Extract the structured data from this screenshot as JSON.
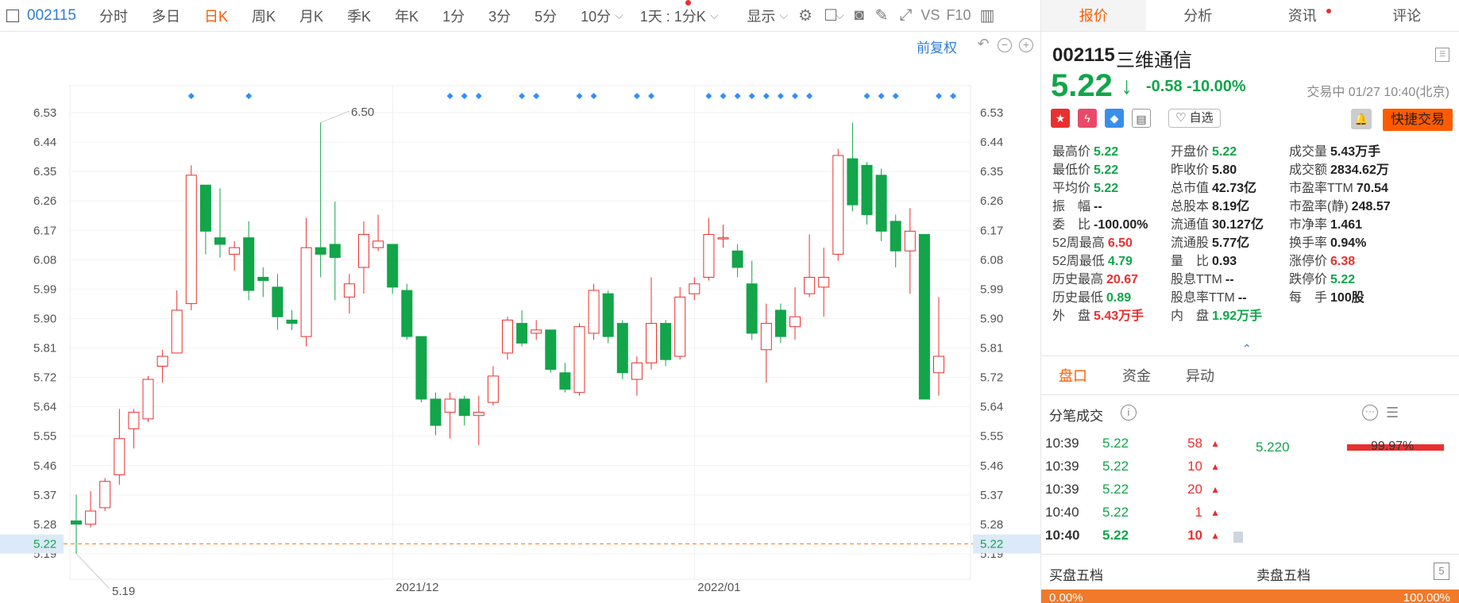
{
  "toolbar": {
    "code": "002115",
    "items": [
      "分时",
      "多日",
      "日K",
      "周K",
      "月K",
      "季K",
      "年K",
      "1分",
      "3分",
      "5分",
      "10分"
    ],
    "active_index": 2,
    "period_select": "1天 : 1分K",
    "display_label": "显示",
    "vs_label": "VS",
    "f10_label": "F10"
  },
  "chart": {
    "fuquan_label": "前复权",
    "max_label": "6.50",
    "min_label": "5.19",
    "current_price_label": "5.22"
  },
  "chart_data": {
    "type": "candlestick",
    "y_ticks": [
      "6.53",
      "6.44",
      "6.35",
      "6.26",
      "6.17",
      "6.08",
      "5.99",
      "5.90",
      "5.81",
      "5.72",
      "5.64",
      "5.55",
      "5.46",
      "5.37",
      "5.28",
      "5.19"
    ],
    "ylim": [
      5.19,
      6.53
    ],
    "x_labels": [
      "2021/12",
      "2022/01"
    ],
    "x_label_positions": [
      22,
      43
    ],
    "candles": [
      {
        "o": 5.29,
        "c": 5.28,
        "h": 5.37,
        "l": 5.19
      },
      {
        "o": 5.28,
        "c": 5.32,
        "h": 5.38,
        "l": 5.27
      },
      {
        "o": 5.33,
        "c": 5.41,
        "h": 5.42,
        "l": 5.32
      },
      {
        "o": 5.43,
        "c": 5.54,
        "h": 5.63,
        "l": 5.4
      },
      {
        "o": 5.57,
        "c": 5.62,
        "h": 5.63,
        "l": 5.51
      },
      {
        "o": 5.6,
        "c": 5.72,
        "h": 5.73,
        "l": 5.59
      },
      {
        "o": 5.76,
        "c": 5.79,
        "h": 5.81,
        "l": 5.71
      },
      {
        "o": 5.8,
        "c": 5.93,
        "h": 5.99,
        "l": 5.8
      },
      {
        "o": 5.95,
        "c": 6.34,
        "h": 6.37,
        "l": 5.93
      },
      {
        "o": 6.31,
        "c": 6.17,
        "h": 6.31,
        "l": 6.1
      },
      {
        "o": 6.15,
        "c": 6.13,
        "h": 6.3,
        "l": 6.09
      },
      {
        "o": 6.1,
        "c": 6.12,
        "h": 6.14,
        "l": 6.05
      },
      {
        "o": 6.15,
        "c": 5.99,
        "h": 6.2,
        "l": 5.96
      },
      {
        "o": 6.03,
        "c": 6.02,
        "h": 6.06,
        "l": 5.97
      },
      {
        "o": 6.0,
        "c": 5.91,
        "h": 6.04,
        "l": 5.87
      },
      {
        "o": 5.9,
        "c": 5.89,
        "h": 5.93,
        "l": 5.87
      },
      {
        "o": 5.85,
        "c": 6.12,
        "h": 6.21,
        "l": 5.82
      },
      {
        "o": 6.12,
        "c": 6.1,
        "h": 6.5,
        "l": 6.03
      },
      {
        "o": 6.13,
        "c": 6.09,
        "h": 6.26,
        "l": 5.96
      },
      {
        "o": 5.97,
        "c": 6.01,
        "h": 6.04,
        "l": 5.92
      },
      {
        "o": 6.06,
        "c": 6.16,
        "h": 6.2,
        "l": 5.98
      },
      {
        "o": 6.12,
        "c": 6.14,
        "h": 6.22,
        "l": 6.11
      },
      {
        "o": 6.13,
        "c": 6.0,
        "h": 6.13,
        "l": 5.98
      },
      {
        "o": 5.99,
        "c": 5.85,
        "h": 6.01,
        "l": 5.84
      },
      {
        "o": 5.85,
        "c": 5.66,
        "h": 5.85,
        "l": 5.65
      },
      {
        "o": 5.66,
        "c": 5.58,
        "h": 5.68,
        "l": 5.55
      },
      {
        "o": 5.62,
        "c": 5.66,
        "h": 5.68,
        "l": 5.54
      },
      {
        "o": 5.66,
        "c": 5.61,
        "h": 5.67,
        "l": 5.58
      },
      {
        "o": 5.61,
        "c": 5.62,
        "h": 5.67,
        "l": 5.52
      },
      {
        "o": 5.65,
        "c": 5.73,
        "h": 5.76,
        "l": 5.64
      },
      {
        "o": 5.8,
        "c": 5.9,
        "h": 5.91,
        "l": 5.78
      },
      {
        "o": 5.89,
        "c": 5.83,
        "h": 5.93,
        "l": 5.82
      },
      {
        "o": 5.86,
        "c": 5.87,
        "h": 5.9,
        "l": 5.84
      },
      {
        "o": 5.87,
        "c": 5.75,
        "h": 5.87,
        "l": 5.74
      },
      {
        "o": 5.74,
        "c": 5.69,
        "h": 5.77,
        "l": 5.68
      },
      {
        "o": 5.68,
        "c": 5.88,
        "h": 5.89,
        "l": 5.67
      },
      {
        "o": 5.86,
        "c": 5.99,
        "h": 6.01,
        "l": 5.84
      },
      {
        "o": 5.98,
        "c": 5.85,
        "h": 5.99,
        "l": 5.83
      },
      {
        "o": 5.89,
        "c": 5.74,
        "h": 5.9,
        "l": 5.72
      },
      {
        "o": 5.72,
        "c": 5.77,
        "h": 5.79,
        "l": 5.67
      },
      {
        "o": 5.77,
        "c": 5.89,
        "h": 6.03,
        "l": 5.75
      },
      {
        "o": 5.89,
        "c": 5.78,
        "h": 5.9,
        "l": 5.76
      },
      {
        "o": 5.79,
        "c": 5.97,
        "h": 6.0,
        "l": 5.78
      },
      {
        "o": 5.98,
        "c": 6.01,
        "h": 6.03,
        "l": 5.96
      },
      {
        "o": 6.03,
        "c": 6.16,
        "h": 6.21,
        "l": 6.02
      },
      {
        "o": 6.15,
        "c": 6.15,
        "h": 6.19,
        "l": 6.12
      },
      {
        "o": 6.11,
        "c": 6.06,
        "h": 6.13,
        "l": 6.03
      },
      {
        "o": 6.01,
        "c": 5.86,
        "h": 6.08,
        "l": 5.84
      },
      {
        "o": 5.81,
        "c": 5.89,
        "h": 5.95,
        "l": 5.71
      },
      {
        "o": 5.93,
        "c": 5.85,
        "h": 5.95,
        "l": 5.83
      },
      {
        "o": 5.88,
        "c": 5.91,
        "h": 6.0,
        "l": 5.84
      },
      {
        "o": 5.98,
        "c": 6.03,
        "h": 6.16,
        "l": 5.97
      },
      {
        "o": 6.0,
        "c": 6.03,
        "h": 6.12,
        "l": 5.91
      },
      {
        "o": 6.1,
        "c": 6.4,
        "h": 6.42,
        "l": 6.08
      },
      {
        "o": 6.39,
        "c": 6.25,
        "h": 6.5,
        "l": 6.23
      },
      {
        "o": 6.37,
        "c": 6.22,
        "h": 6.38,
        "l": 6.19
      },
      {
        "o": 6.34,
        "c": 6.17,
        "h": 6.36,
        "l": 6.14
      },
      {
        "o": 6.2,
        "c": 6.11,
        "h": 6.22,
        "l": 6.06
      },
      {
        "o": 6.11,
        "c": 6.17,
        "h": 6.24,
        "l": 5.98
      },
      {
        "o": 6.16,
        "c": 5.66,
        "h": 6.16,
        "l": 5.66
      },
      {
        "o": 5.74,
        "c": 5.79,
        "h": 5.97,
        "l": 5.67
      }
    ],
    "markers": [
      8,
      12,
      26,
      27,
      28,
      31,
      32,
      35,
      36,
      39,
      40,
      44,
      45,
      46,
      47,
      48,
      49,
      50,
      51,
      55,
      56,
      57,
      60,
      61
    ],
    "current_price": 5.22,
    "colors": {
      "up": "#e93030",
      "down": "#12a54a",
      "marker": "#2f8fff"
    }
  },
  "panel": {
    "tabs": [
      "报价",
      "分析",
      "资讯",
      "评论"
    ],
    "code": "002115",
    "name": "三维通信",
    "price": "5.22",
    "change": "-0.58",
    "change_pct": "-10.00%",
    "status": "交易中 01/27 10:40(北京)",
    "zixuan_label": "自选",
    "quick_trade_label": "快捷交易",
    "stats": [
      {
        "label": "最高价",
        "value": "5.22",
        "color": "green"
      },
      {
        "label": "开盘价",
        "value": "5.22",
        "color": "green"
      },
      {
        "label": "成交量",
        "value": "5.43万手",
        "color": ""
      },
      {
        "label": "最低价",
        "value": "5.22",
        "color": "green"
      },
      {
        "label": "昨收价",
        "value": "5.80",
        "color": ""
      },
      {
        "label": "成交额",
        "value": "2834.62万",
        "color": ""
      },
      {
        "label": "平均价",
        "value": "5.22",
        "color": "green"
      },
      {
        "label": "总市值",
        "value": "42.73亿",
        "color": ""
      },
      {
        "label": "市盈率TTM",
        "value": "70.54",
        "color": ""
      },
      {
        "label": "振　幅",
        "value": "--",
        "color": ""
      },
      {
        "label": "总股本",
        "value": "8.19亿",
        "color": ""
      },
      {
        "label": "市盈率(静)",
        "value": "248.57",
        "color": ""
      },
      {
        "label": "委　比",
        "value": "-100.00%",
        "color": ""
      },
      {
        "label": "流通值",
        "value": "30.127亿",
        "color": ""
      },
      {
        "label": "市净率",
        "value": "1.461",
        "color": ""
      },
      {
        "label": "52周最高",
        "value": "6.50",
        "color": "red"
      },
      {
        "label": "流通股",
        "value": "5.77亿",
        "color": ""
      },
      {
        "label": "换手率",
        "value": "0.94%",
        "color": ""
      },
      {
        "label": "52周最低",
        "value": "4.79",
        "color": "green"
      },
      {
        "label": "量　比",
        "value": "0.93",
        "color": ""
      },
      {
        "label": "涨停价",
        "value": "6.38",
        "color": "red"
      },
      {
        "label": "历史最高",
        "value": "20.67",
        "color": "red"
      },
      {
        "label": "股息TTM",
        "value": "--",
        "color": ""
      },
      {
        "label": "跌停价",
        "value": "5.22",
        "color": "green"
      },
      {
        "label": "历史最低",
        "value": "0.89",
        "color": "green"
      },
      {
        "label": "股息率TTM",
        "value": "--",
        "color": ""
      },
      {
        "label": "每　手",
        "value": "100股",
        "color": ""
      },
      {
        "label": "外　盘",
        "value": "5.43万手",
        "color": "red"
      },
      {
        "label": "内　盘",
        "value": "1.92万手",
        "color": "green"
      }
    ],
    "subtabs": [
      "盘口",
      "资金",
      "异动"
    ],
    "trades_title": "分笔成交",
    "trades": [
      {
        "time": "10:39",
        "price": "5.22",
        "vol": "58"
      },
      {
        "time": "10:39",
        "price": "5.22",
        "vol": "10"
      },
      {
        "time": "10:39",
        "price": "5.22",
        "vol": "20"
      },
      {
        "time": "10:40",
        "price": "5.22",
        "vol": "1"
      },
      {
        "time": "10:40",
        "price": "5.22",
        "vol": "10"
      }
    ],
    "dist_price": "5.220",
    "dist_pct": "99.97%",
    "buy5_label": "买盘五档",
    "sell5_label": "卖盘五档",
    "buy_pct": "0.00%",
    "sell_pct": "100.00%"
  }
}
